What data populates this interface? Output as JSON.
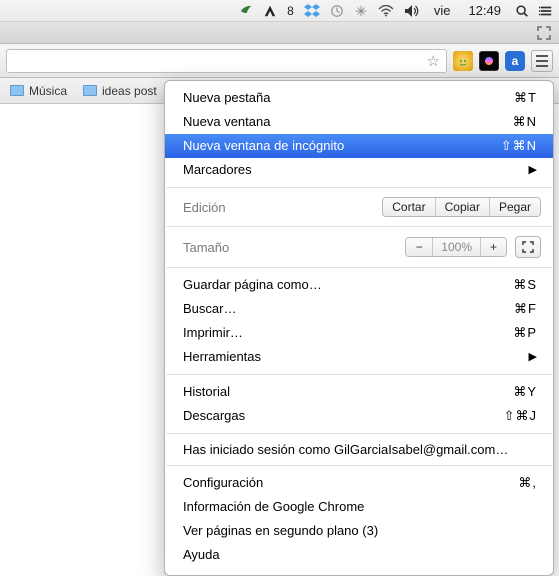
{
  "menubar": {
    "adobe_badge": "8",
    "day": "vie",
    "time": "12:49"
  },
  "bookmarks": {
    "item1": "Música",
    "item2": "ideas post"
  },
  "menu": {
    "new_tab": {
      "label": "Nueva pestaña",
      "shortcut": "⌘T"
    },
    "new_window": {
      "label": "Nueva ventana",
      "shortcut": "⌘N"
    },
    "incognito": {
      "label": "Nueva ventana de incógnito",
      "shortcut": "⇧⌘N"
    },
    "bookmarks": {
      "label": "Marcadores"
    },
    "edit": {
      "label": "Edición",
      "cut": "Cortar",
      "copy": "Copiar",
      "paste": "Pegar"
    },
    "zoom": {
      "label": "Tamaño",
      "minus": "−",
      "pct": "100%",
      "plus": "+"
    },
    "save_as": {
      "label": "Guardar página como…",
      "shortcut": "⌘S"
    },
    "find": {
      "label": "Buscar…",
      "shortcut": "⌘F"
    },
    "print": {
      "label": "Imprimir…",
      "shortcut": "⌘P"
    },
    "tools": {
      "label": "Herramientas"
    },
    "history": {
      "label": "Historial",
      "shortcut": "⌘Y"
    },
    "downloads": {
      "label": "Descargas",
      "shortcut": "⇧⌘J"
    },
    "signed_in": "Has iniciado sesión como GilGarciaIsabel@gmail.com…",
    "settings": {
      "label": "Configuración",
      "shortcut": "⌘,"
    },
    "about": "Información de Google Chrome",
    "bg_pages": "Ver páginas en segundo plano (3)",
    "help": "Ayuda"
  }
}
